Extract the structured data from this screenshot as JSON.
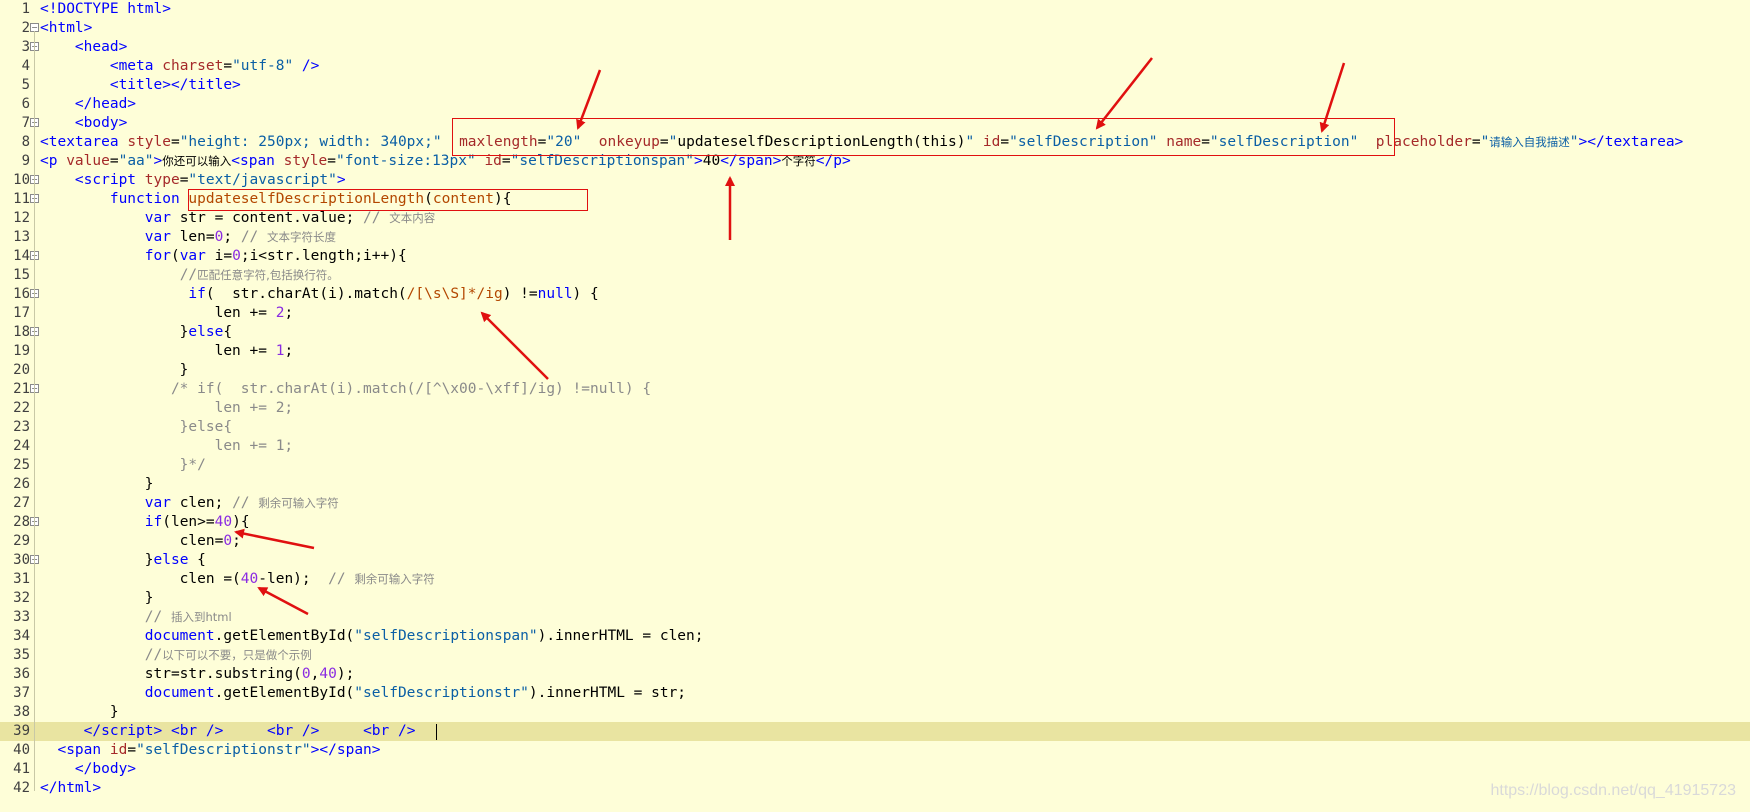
{
  "editor": {
    "lines": [
      {
        "num": "1",
        "fold": false,
        "html": "<span class='kw'>&lt;!DOCTYPE html&gt;</span>"
      },
      {
        "num": "2",
        "fold": true,
        "html": "<span class='kw'>&lt;html&gt;</span>"
      },
      {
        "num": "3",
        "fold": true,
        "html": "    <span class='kw'>&lt;head&gt;</span>"
      },
      {
        "num": "4",
        "fold": false,
        "html": "        <span class='kw'>&lt;meta</span> <span class='at'>charset</span>=<span class='st'>\"utf-8\"</span> <span class='kw'>/&gt;</span>"
      },
      {
        "num": "5",
        "fold": false,
        "html": "        <span class='kw'>&lt;title&gt;&lt;/title&gt;</span>"
      },
      {
        "num": "6",
        "fold": false,
        "html": "    <span class='kw'>&lt;/head&gt;</span>"
      },
      {
        "num": "7",
        "fold": true,
        "html": "    <span class='kw'>&lt;body&gt;</span>"
      },
      {
        "num": "8",
        "fold": false,
        "html": "<span class='kw'>&lt;textarea</span> <span class='at'>style</span>=<span class='st'>\"height: 250px; width: 340px;\"</span>  <span class='at'>maxlength</span>=<span class='st'>\"20\"</span>  <span class='at'>onkeyup</span>=<span class='st'>\"</span><span class='tx'>updateselfDescriptionLength(this)</span><span class='st'>\"</span> <span class='at'>id</span>=<span class='st'>\"selfDescription\"</span> <span class='at'>name</span>=<span class='st'>\"selfDescription\"</span>  <span class='at'>placeholder</span>=<span class='st'>\"<span class='cjk'>请输入自我描述</span>\"</span><span class='kw'>&gt;&lt;/textarea&gt;</span>"
      },
      {
        "num": "9",
        "fold": false,
        "html": "<span class='kw'>&lt;p</span> <span class='at'>value</span>=<span class='st'>\"aa\"</span><span class='kw'>&gt;</span><span class='cjk'>你还可以输入</span><span class='kw'>&lt;span</span> <span class='at'>style</span>=<span class='st'>\"font-size:13px\"</span> <span class='at'>id</span>=<span class='st'>\"selfDescriptionspan\"</span><span class='kw'>&gt;</span>40<span class='kw'>&lt;/span&gt;</span><span class='cjk'>个字符</span><span class='kw'>&lt;/p&gt;</span>"
      },
      {
        "num": "10",
        "fold": true,
        "html": "    <span class='kw'>&lt;script</span> <span class='at'>type</span>=<span class='st'>\"text/javascript\"</span><span class='kw'>&gt;</span>"
      },
      {
        "num": "11",
        "fold": true,
        "html": "        <span class='kw'>function</span> <span class='fn'>updateselfDescriptionLength</span>(<span class='fn'>content</span>){"
      },
      {
        "num": "12",
        "fold": false,
        "html": "            <span class='kw'>var</span> str = content.value; <span class='cm'>// <span class='cjk'>文本内容</span></span>"
      },
      {
        "num": "13",
        "fold": false,
        "html": "            <span class='kw'>var</span> len=<span class='nm'>0</span>; <span class='cm'>// <span class='cjk'>文本字符长度</span></span>"
      },
      {
        "num": "14",
        "fold": true,
        "html": "            <span class='kw'>for</span>(<span class='kw'>var</span> i=<span class='nm'>0</span>;i&lt;str.length;i++){"
      },
      {
        "num": "15",
        "fold": false,
        "html": "                <span class='cm'>//<span class='cjk'>匹配任意字符,包括换行符。</span></span>"
      },
      {
        "num": "16",
        "fold": true,
        "html": "                 <span class='kw'>if</span>(  str.charAt(i).match(<span class='fn'>/[\\s\\S]*/ig</span>) !=<span class='kw'>null</span>) {"
      },
      {
        "num": "17",
        "fold": false,
        "html": "                    len += <span class='nm'>2</span>;"
      },
      {
        "num": "18",
        "fold": true,
        "html": "                }<span class='kw'>else</span>{"
      },
      {
        "num": "19",
        "fold": false,
        "html": "                    len += <span class='nm'>1</span>;"
      },
      {
        "num": "20",
        "fold": false,
        "html": "                }"
      },
      {
        "num": "21",
        "fold": true,
        "html": "               <span class='cm'>/* if(  str.charAt(i).match(/[^\\x00-\\xff]/ig) !=null) {</span>"
      },
      {
        "num": "22",
        "fold": false,
        "html": "<span class='cm'>                    len += 2;</span>"
      },
      {
        "num": "23",
        "fold": false,
        "html": "<span class='cm'>                }else{</span>"
      },
      {
        "num": "24",
        "fold": false,
        "html": "<span class='cm'>                    len += 1;</span>"
      },
      {
        "num": "25",
        "fold": false,
        "html": "<span class='cm'>                }*/</span>"
      },
      {
        "num": "26",
        "fold": false,
        "html": "            }"
      },
      {
        "num": "27",
        "fold": false,
        "html": "            <span class='kw'>var</span> clen; <span class='cm'>// <span class='cjk'>剩余可输入字符</span></span>"
      },
      {
        "num": "28",
        "fold": true,
        "html": "            <span class='kw'>if</span>(len&gt;=<span class='nm'>40</span>){"
      },
      {
        "num": "29",
        "fold": false,
        "html": "                clen=<span class='nm'>0</span>;"
      },
      {
        "num": "30",
        "fold": true,
        "html": "            }<span class='kw'>else</span> {"
      },
      {
        "num": "31",
        "fold": false,
        "html": "                clen =(<span class='nm'>40</span>-len);  <span class='cm'>// <span class='cjk'>剩余可输入字符</span></span>"
      },
      {
        "num": "32",
        "fold": false,
        "html": "            }"
      },
      {
        "num": "33",
        "fold": false,
        "html": "            <span class='cm'>// <span class='cjk'>插入到html</span></span>"
      },
      {
        "num": "34",
        "fold": false,
        "html": "            <span class='kw'>document</span>.getElementById(<span class='st'>\"selfDescriptionspan\"</span>).innerHTML = clen;"
      },
      {
        "num": "35",
        "fold": false,
        "html": "            <span class='cm'>//<span class='cjk'>以下可以不要，只是做个示例</span></span>"
      },
      {
        "num": "36",
        "fold": false,
        "html": "            str=str.substring(<span class='nm'>0</span>,<span class='nm'>40</span>);"
      },
      {
        "num": "37",
        "fold": false,
        "html": "            <span class='kw'>document</span>.getElementById(<span class='st'>\"selfDescriptionstr\"</span>).innerHTML = str;"
      },
      {
        "num": "38",
        "fold": false,
        "html": "        }"
      },
      {
        "num": "39",
        "fold": false,
        "current": true,
        "html": "     <span class='kw'>&lt;/script&gt;</span> <span class='kw'>&lt;br /&gt;</span>     <span class='kw'>&lt;br /&gt;</span>     <span class='kw'>&lt;br /&gt;</span>"
      },
      {
        "num": "40",
        "fold": false,
        "html": "  <span class='kw'>&lt;span</span> <span class='at'>id</span>=<span class='st'>\"selfDescriptionstr\"</span><span class='kw'>&gt;&lt;/span&gt;</span>"
      },
      {
        "num": "41",
        "fold": false,
        "html": "    <span class='kw'>&lt;/body&gt;</span>"
      },
      {
        "num": "42",
        "fold": false,
        "html": "<span class='kw'>&lt;/html&gt;</span>"
      }
    ]
  },
  "annotations": {
    "color": "#e01010",
    "box_line8": "maxlength, onkeyup, id, name attributes",
    "box_line11": "function name and parameter"
  },
  "watermark": "https://blog.csdn.net/qq_41915723",
  "colors": {
    "background": "#fefed8",
    "current_line": "#e9e4a1",
    "keyword": "#0000ff",
    "attribute": "#a52a2a",
    "string": "#0b5fa5",
    "number": "#8a2be2",
    "comment": "#8a8a8a"
  }
}
